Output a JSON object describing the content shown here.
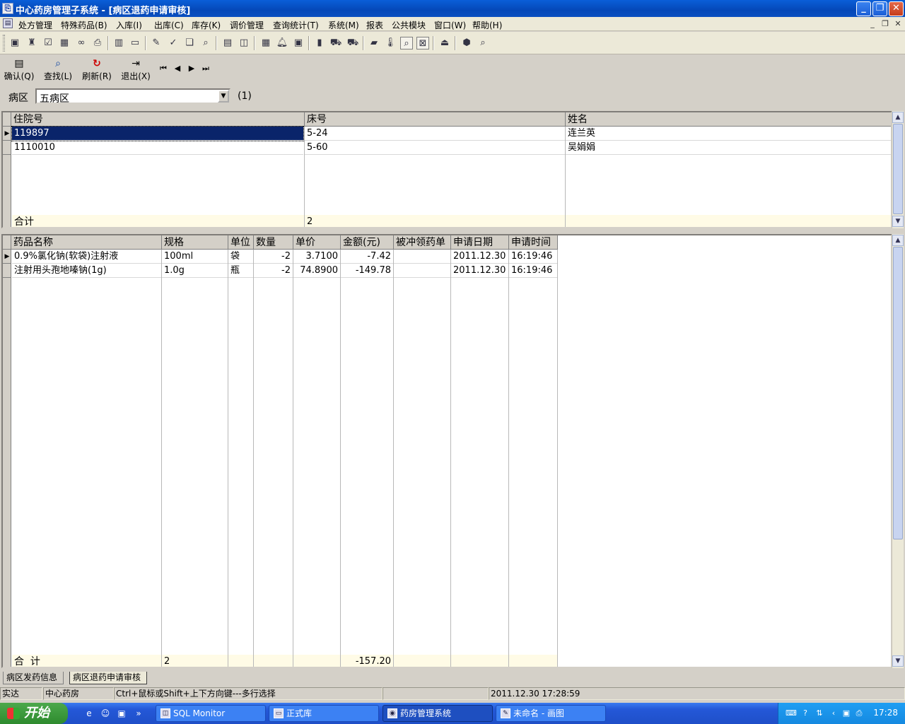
{
  "window": {
    "title": "中心药房管理子系统 - [病区退药申请审核]",
    "app_icon": "app-icon"
  },
  "menu": {
    "items": [
      "处方管理",
      "特殊药品(B)",
      "入库(I)",
      "出库(C)",
      "库存(K)",
      "调价管理",
      "查询统计(T)",
      "系统(M)",
      "报表",
      "公共模块",
      "窗口(W)",
      "帮助(H)"
    ]
  },
  "actions": {
    "confirm": "确认(Q)",
    "find": "查找(L)",
    "refresh": "刷新(R)",
    "exit": "退出(X)"
  },
  "ward": {
    "label": "病区",
    "value": "五病区",
    "count": "(1)"
  },
  "patients": {
    "columns": [
      "住院号",
      "床号",
      "姓名"
    ],
    "rows": [
      {
        "id": "119897",
        "bed": "5-24",
        "name": "连兰英"
      },
      {
        "id": "1110010",
        "bed": "5-60",
        "name": "吴娟娟"
      }
    ],
    "summary": {
      "label": "合计",
      "count": "2"
    }
  },
  "drugs": {
    "columns": [
      "药品名称",
      "规格",
      "单位",
      "数量",
      "单价",
      "金额(元)",
      "被冲领药单",
      "申请日期",
      "申请时间"
    ],
    "rows": [
      {
        "name": "0.9%氯化钠(软袋)注射液",
        "spec": "100ml",
        "unit": "袋",
        "qty": "-2",
        "price": "3.7100",
        "amount": "-7.42",
        "ref": "",
        "date": "2011.12.30",
        "time": "16:19:46"
      },
      {
        "name": "注射用头孢地嗪钠(1g)",
        "spec": "1.0g",
        "unit": "瓶",
        "qty": "-2",
        "price": "74.8900",
        "amount": "-149.78",
        "ref": "",
        "date": "2011.12.30",
        "time": "16:19:46"
      }
    ],
    "summary": {
      "label": "合  计",
      "count": "2",
      "amount": "-157.20"
    }
  },
  "tabs": [
    "病区发药信息",
    "病区退药申请审核"
  ],
  "status": {
    "user": "实达",
    "dept": "中心药房",
    "hint": "Ctrl+鼠标或Shift+上下方向键---多行选择",
    "datetime": "2011.12.30 17:28:59"
  },
  "taskbar": {
    "start": "开始",
    "tasks": [
      "SQL Monitor",
      "正式库",
      "药房管理系统",
      "未命名 - 画图"
    ],
    "clock": "17:28"
  }
}
